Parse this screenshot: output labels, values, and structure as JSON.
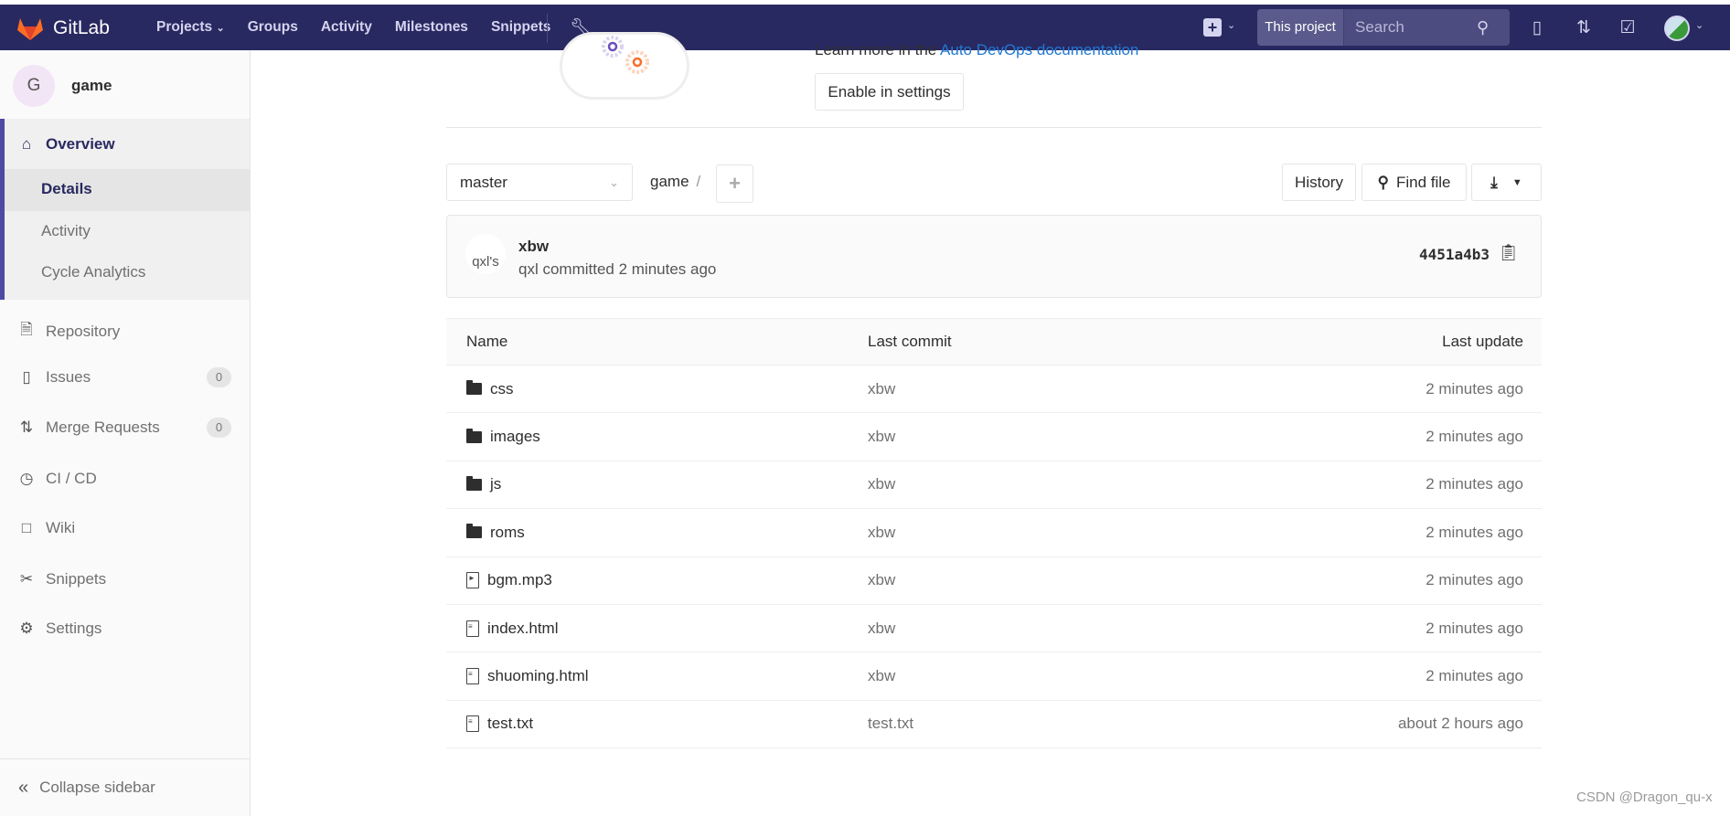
{
  "nav": {
    "brand": "GitLab",
    "links": [
      "Projects",
      "Groups",
      "Activity",
      "Milestones",
      "Snippets"
    ],
    "search_scope": "This project",
    "search_placeholder": "Search",
    "color": "#292961"
  },
  "sidebar": {
    "project_initial": "G",
    "project_name": "game",
    "overview": "Overview",
    "sub_items": [
      "Details",
      "Activity",
      "Cycle Analytics"
    ],
    "items": [
      {
        "label": "Repository",
        "icon": "document-icon"
      },
      {
        "label": "Issues",
        "icon": "issues-icon",
        "count": "0"
      },
      {
        "label": "Merge Requests",
        "icon": "merge-request-icon",
        "count": "0"
      },
      {
        "label": "CI / CD",
        "icon": "rocket-gauge-icon"
      },
      {
        "label": "Wiki",
        "icon": "book-icon"
      },
      {
        "label": "Snippets",
        "icon": "scissors-icon"
      },
      {
        "label": "Settings",
        "icon": "gear-icon"
      }
    ],
    "collapse": "Collapse sidebar"
  },
  "autodevops": {
    "learn_prefix": "Learn more in the ",
    "learn_link": "Auto DevOps documentation",
    "enable_button": "Enable in settings"
  },
  "toolbar": {
    "branch": "master",
    "path": "game",
    "separator": "/",
    "history": "History",
    "find_file": "Find file"
  },
  "commit": {
    "avatar_alt": "qxl's",
    "title": "xbw",
    "meta": "qxl committed 2 minutes ago",
    "sha": "4451a4b3"
  },
  "table": {
    "headers": [
      "Name",
      "Last commit",
      "Last update"
    ],
    "rows": [
      {
        "type": "folder",
        "name": "css",
        "commit": "xbw",
        "updated": "2 minutes ago"
      },
      {
        "type": "folder",
        "name": "images",
        "commit": "xbw",
        "updated": "2 minutes ago"
      },
      {
        "type": "folder",
        "name": "js",
        "commit": "xbw",
        "updated": "2 minutes ago"
      },
      {
        "type": "folder",
        "name": "roms",
        "commit": "xbw",
        "updated": "2 minutes ago"
      },
      {
        "type": "audio",
        "name": "bgm.mp3",
        "commit": "xbw",
        "updated": "2 minutes ago"
      },
      {
        "type": "file",
        "name": "index.html",
        "commit": "xbw",
        "updated": "2 minutes ago"
      },
      {
        "type": "file",
        "name": "shuoming.html",
        "commit": "xbw",
        "updated": "2 minutes ago"
      },
      {
        "type": "file",
        "name": "test.txt",
        "commit": "test.txt",
        "updated": "about 2 hours ago"
      }
    ]
  },
  "watermark": "CSDN @Dragon_qu-x"
}
